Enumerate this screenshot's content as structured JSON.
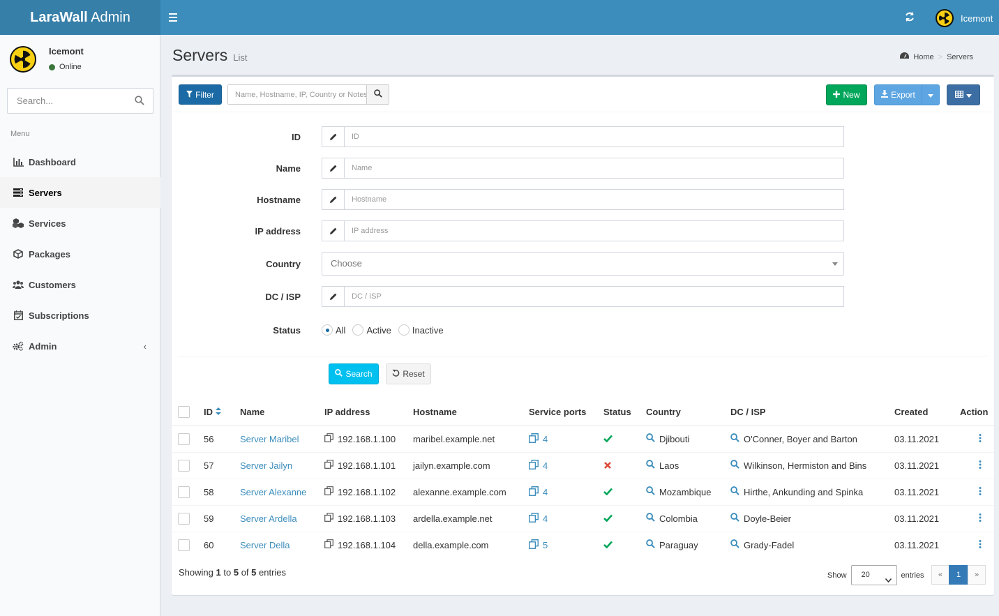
{
  "app": {
    "logo_bold": "LaraWall",
    "logo_rest": " Admin"
  },
  "header": {
    "user_name": "Icemont"
  },
  "sidebar": {
    "user_name": "Icemont",
    "status": "Online",
    "search_placeholder": "Search...",
    "menu_header": "Menu",
    "items": [
      {
        "label": "Dashboard",
        "icon": "bar-chart-icon"
      },
      {
        "label": "Servers",
        "icon": "server-icon"
      },
      {
        "label": "Services",
        "icon": "cubes-icon"
      },
      {
        "label": "Packages",
        "icon": "cube-icon"
      },
      {
        "label": "Customers",
        "icon": "users-icon"
      },
      {
        "label": "Subscriptions",
        "icon": "calendar-check-icon"
      },
      {
        "label": "Admin",
        "icon": "cogs-icon"
      }
    ]
  },
  "page": {
    "title": "Servers",
    "subtitle": "List"
  },
  "breadcrumb": {
    "home": "Home",
    "current": "Servers"
  },
  "toolbar": {
    "filter": "Filter",
    "quick_search_placeholder": "Name, Hostname, IP, Country or Notes",
    "new": "New",
    "export": "Export"
  },
  "filter": {
    "id_label": "ID",
    "id_placeholder": "ID",
    "name_label": "Name",
    "name_placeholder": "Name",
    "hostname_label": "Hostname",
    "hostname_placeholder": "Hostname",
    "ip_label": "IP address",
    "ip_placeholder": "IP address",
    "country_label": "Country",
    "country_value": "Choose",
    "dc_label": "DC / ISP",
    "dc_placeholder": "DC / ISP",
    "status_label": "Status",
    "status_options": [
      "All",
      "Active",
      "Inactive"
    ],
    "status_selected": "All",
    "search_button": "Search",
    "reset_button": "Reset"
  },
  "table": {
    "columns": [
      "ID",
      "Name",
      "IP address",
      "Hostname",
      "Service ports",
      "Status",
      "Country",
      "DC / ISP",
      "Created",
      "Action"
    ],
    "rows": [
      {
        "id": "56",
        "name": "Server Maribel",
        "ip": "192.168.1.100",
        "hostname": "maribel.example.net",
        "ports": "4",
        "status": "active",
        "country": "Djibouti",
        "dc": "O'Conner, Boyer and Barton",
        "created": "03.11.2021"
      },
      {
        "id": "57",
        "name": "Server Jailyn",
        "ip": "192.168.1.101",
        "hostname": "jailyn.example.com",
        "ports": "4",
        "status": "inactive",
        "country": "Laos",
        "dc": "Wilkinson, Hermiston and Bins",
        "created": "03.11.2021"
      },
      {
        "id": "58",
        "name": "Server Alexanne",
        "ip": "192.168.1.102",
        "hostname": "alexanne.example.com",
        "ports": "4",
        "status": "active",
        "country": "Mozambique",
        "dc": "Hirthe, Ankunding and Spinka",
        "created": "03.11.2021"
      },
      {
        "id": "59",
        "name": "Server Ardella",
        "ip": "192.168.1.103",
        "hostname": "ardella.example.net",
        "ports": "4",
        "status": "active",
        "country": "Colombia",
        "dc": "Doyle-Beier",
        "created": "03.11.2021"
      },
      {
        "id": "60",
        "name": "Server Della",
        "ip": "192.168.1.104",
        "hostname": "della.example.com",
        "ports": "5",
        "status": "active",
        "country": "Paraguay",
        "dc": "Grady-Fadel",
        "created": "03.11.2021"
      }
    ]
  },
  "footer": {
    "showing": "Showing",
    "from": "1",
    "to_word": "to",
    "to": "5",
    "of_word": "of",
    "total": "5",
    "entries_word": "entries",
    "show_label": "Show",
    "page_length": "20",
    "entries_label": "entries",
    "prev": "«",
    "page": "1",
    "next": "»"
  },
  "colors": {
    "header": "#3c8dbc",
    "logo": "#367fa9",
    "primary": "#1b6aa5",
    "success": "#00a65a",
    "info": "#00c0ef",
    "export": "#5ea6e2",
    "active": "#00a65a",
    "inactive": "#dd4b39"
  }
}
